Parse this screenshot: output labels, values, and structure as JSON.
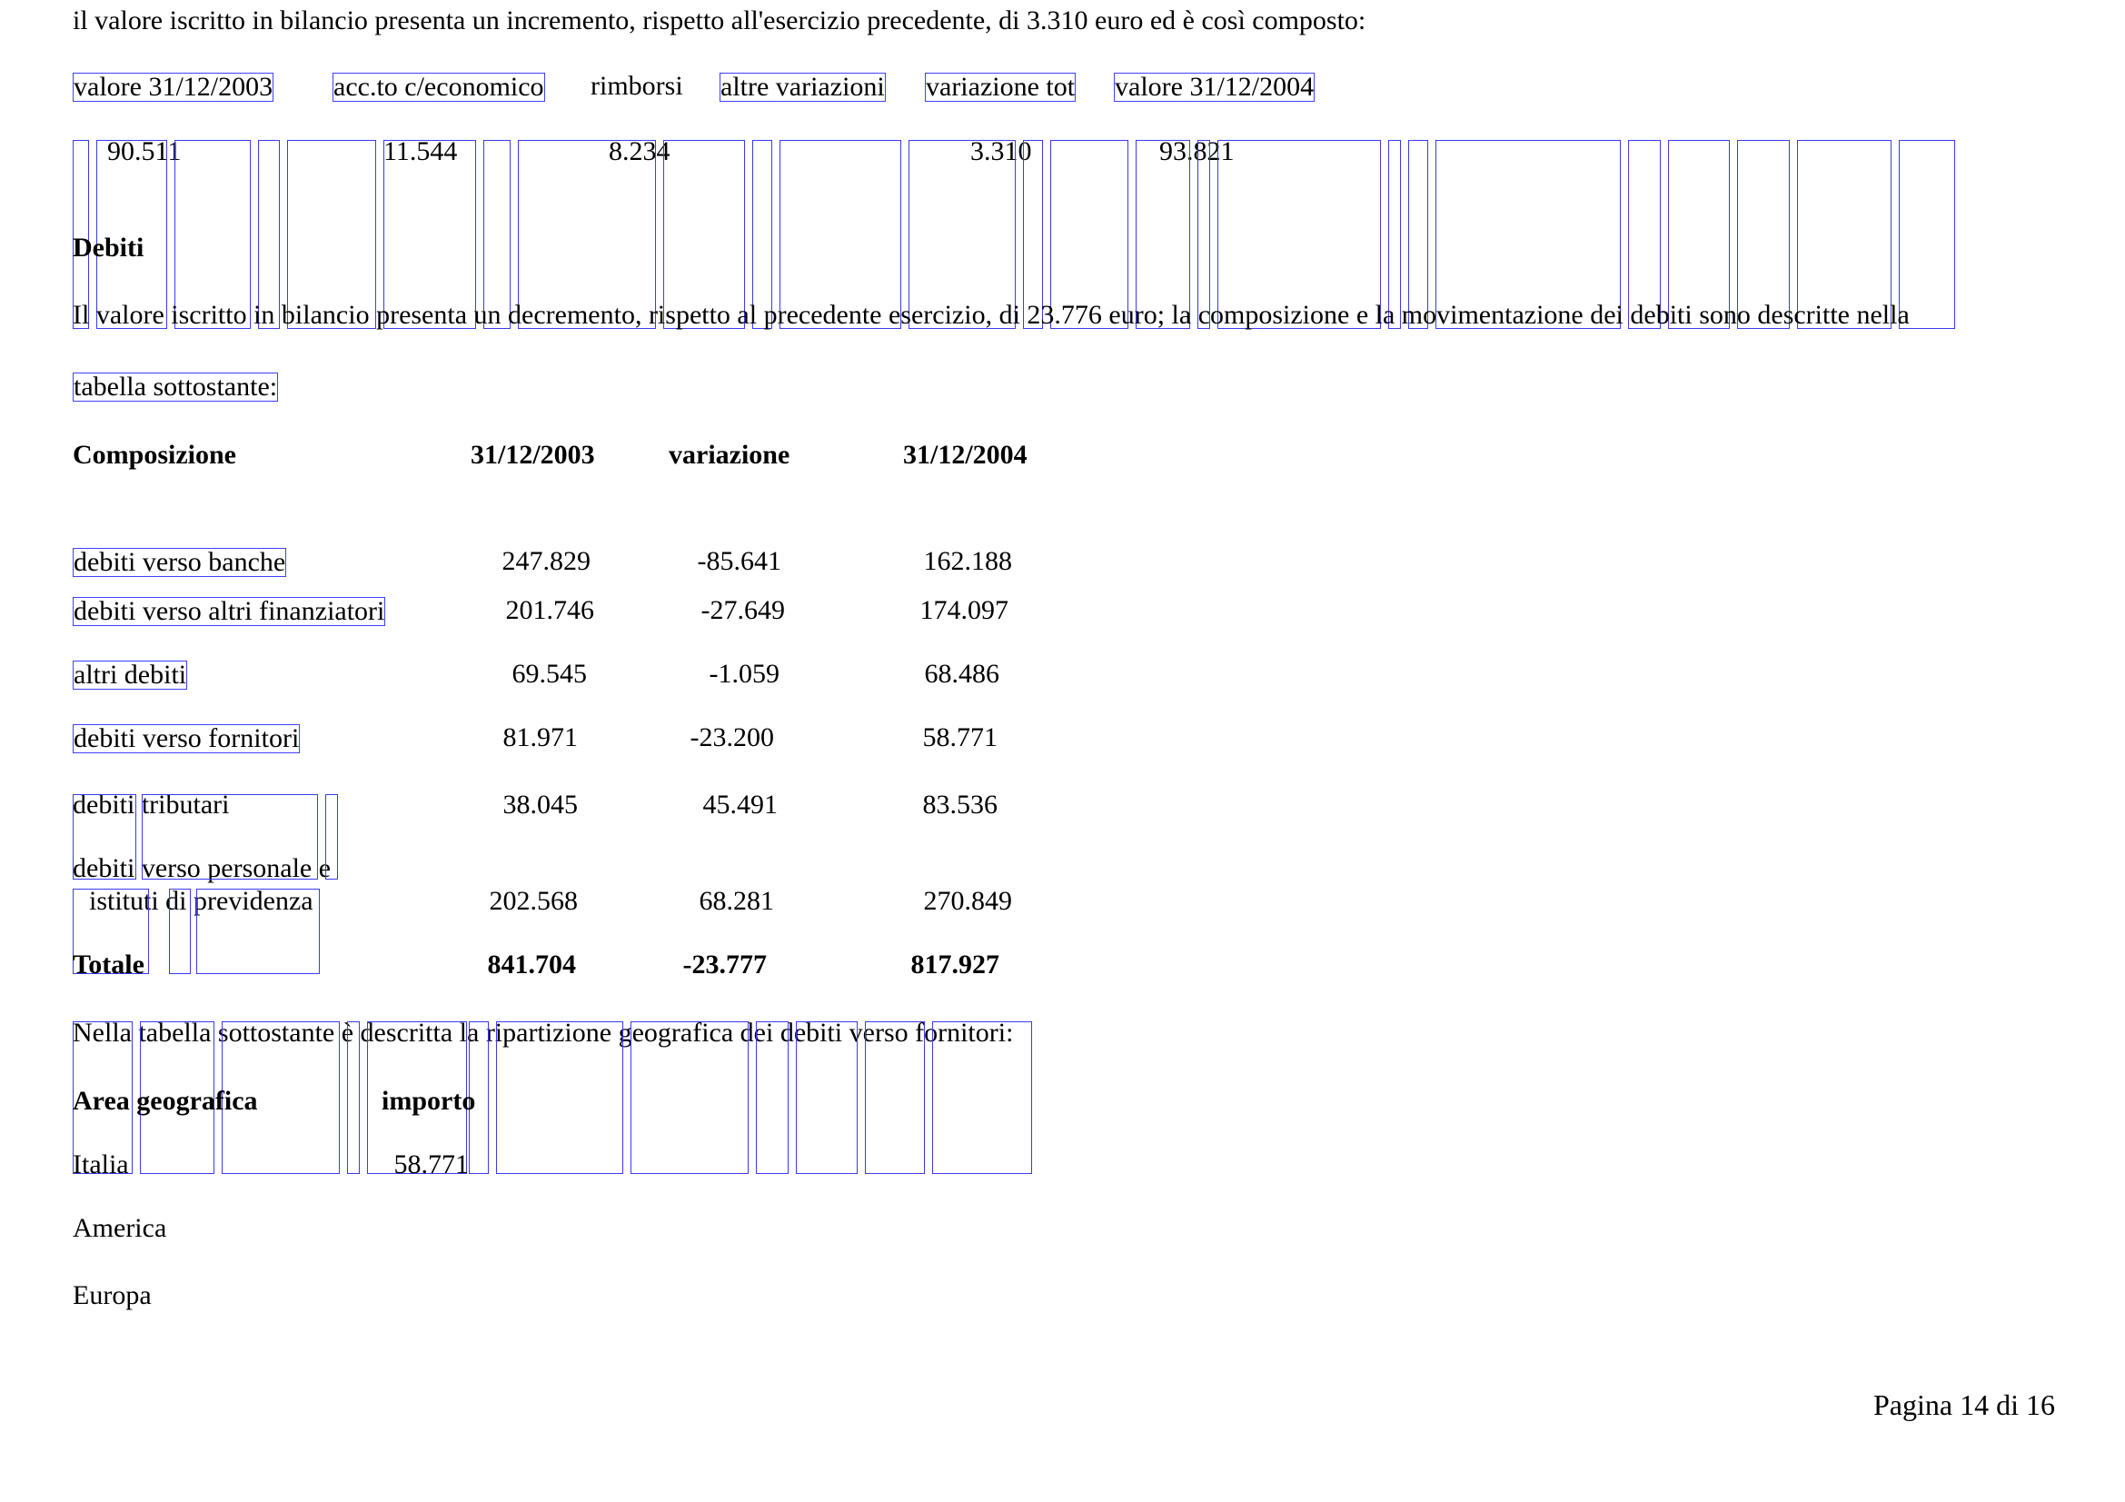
{
  "intro_text": "il valore iscritto in bilancio presenta un incremento, rispetto all'esercizio precedente, di 3.310 euro ed è così composto:",
  "movement_table": {
    "headers": [
      "valore 31/12/2003",
      "acc.to c/economico",
      "rimborsi",
      "altre variazioni",
      "variazione tot",
      "valore 31/12/2004"
    ],
    "values": [
      "90.511",
      "11.544",
      "8.234",
      "",
      "3.310",
      "93.821"
    ]
  },
  "debiti_section": {
    "heading": "Debiti",
    "paragraph_line1": "Il valore iscritto in bilancio presenta un decremento, rispetto al precedente esercizio, di 23.776 euro; la composizione e la movimentazione dei debiti sono descritte nella",
    "paragraph_line2": "tabella sottostante:"
  },
  "composition_table": {
    "headers": [
      "Composizione",
      "31/12/2003",
      "variazione",
      "31/12/2004"
    ],
    "rows": [
      {
        "label": "debiti verso banche",
        "v2003": "247.829",
        "change": "-85.641",
        "v2004": "162.188"
      },
      {
        "label": "debiti verso altri finanziatori",
        "v2003": "201.746",
        "change": "-27.649",
        "v2004": "174.097"
      },
      {
        "label": "altri debiti",
        "v2003": "69.545",
        "change": "-1.059",
        "v2004": "68.486"
      },
      {
        "label": "debiti verso fornitori",
        "v2003": "81.971",
        "change": "-23.200",
        "v2004": "58.771"
      },
      {
        "label": "debiti tributari",
        "v2003": "38.045",
        "change": "45.491",
        "v2004": "83.536"
      },
      {
        "label_line1": "debiti verso personale e",
        "label_line2": "istituti di previdenza",
        "v2003": "202.568",
        "change": "68.281",
        "v2004": "270.849"
      }
    ],
    "total": {
      "label": "Totale",
      "v2003": "841.704",
      "change": "-23.777",
      "v2004": "817.927"
    }
  },
  "geo_intro": "Nella tabella sottostante è descritta la ripartizione geografica dei debiti verso fornitori:",
  "geo_table": {
    "headers": [
      "Area geografica",
      "importo"
    ],
    "rows": [
      {
        "area": "Italia",
        "amount": "58.771"
      },
      {
        "area": "America",
        "amount": ""
      },
      {
        "area": "Europa",
        "amount": ""
      }
    ]
  },
  "footer": {
    "page_label": "Pagina 14 di 16"
  },
  "colors": {
    "text": "#000000",
    "word_box": "#3a3aee",
    "background": "#ffffff"
  }
}
